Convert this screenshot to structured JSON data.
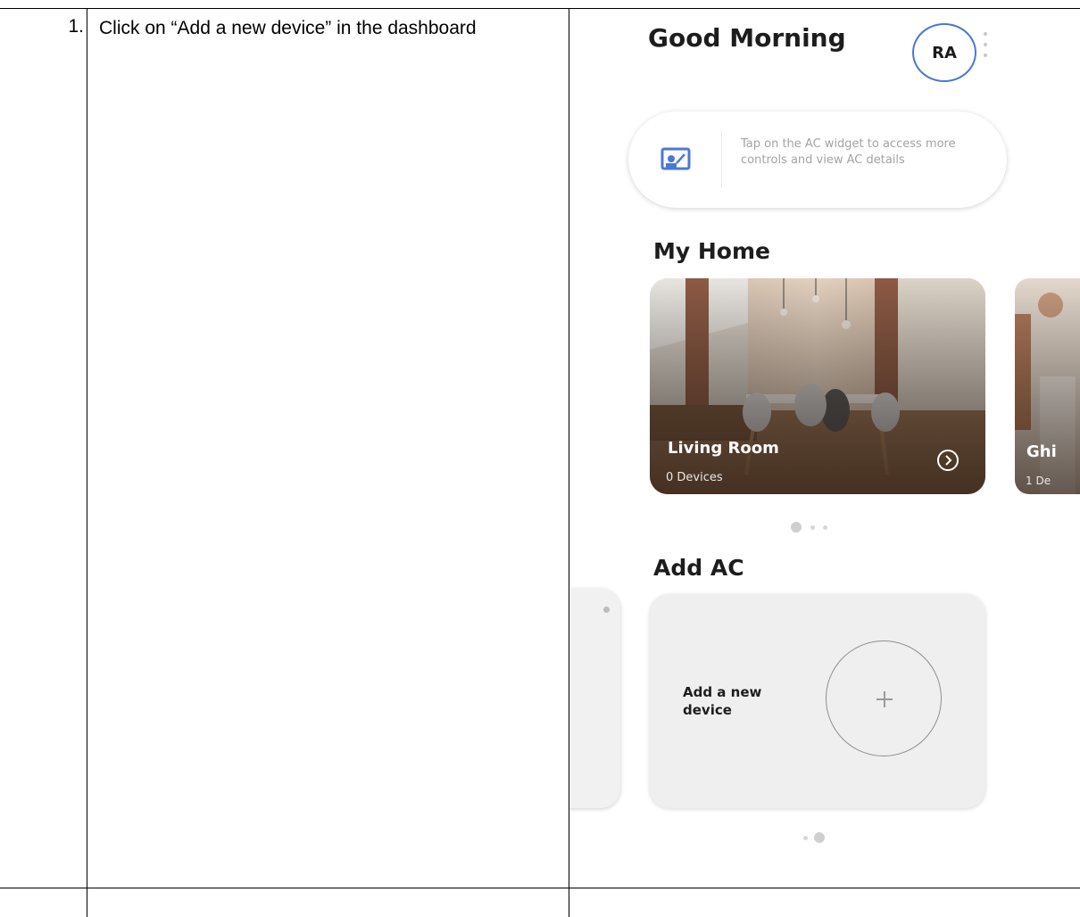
{
  "step": {
    "number": "1.",
    "instruction": "Click on “Add a new device” in the dashboard"
  },
  "app": {
    "greeting": "Good Morning",
    "avatar_initials": "RA",
    "tip_text": "Tap on the AC widget to access more controls and view AC details",
    "my_home_title": "My Home",
    "rooms": [
      {
        "name": "Living Room",
        "devices": "0 Devices"
      },
      {
        "name": "Ghi",
        "devices": "1 De"
      }
    ],
    "add_ac_title": "Add AC",
    "add_device_label": "Add a new device",
    "accent_color": "#4a78d6"
  }
}
